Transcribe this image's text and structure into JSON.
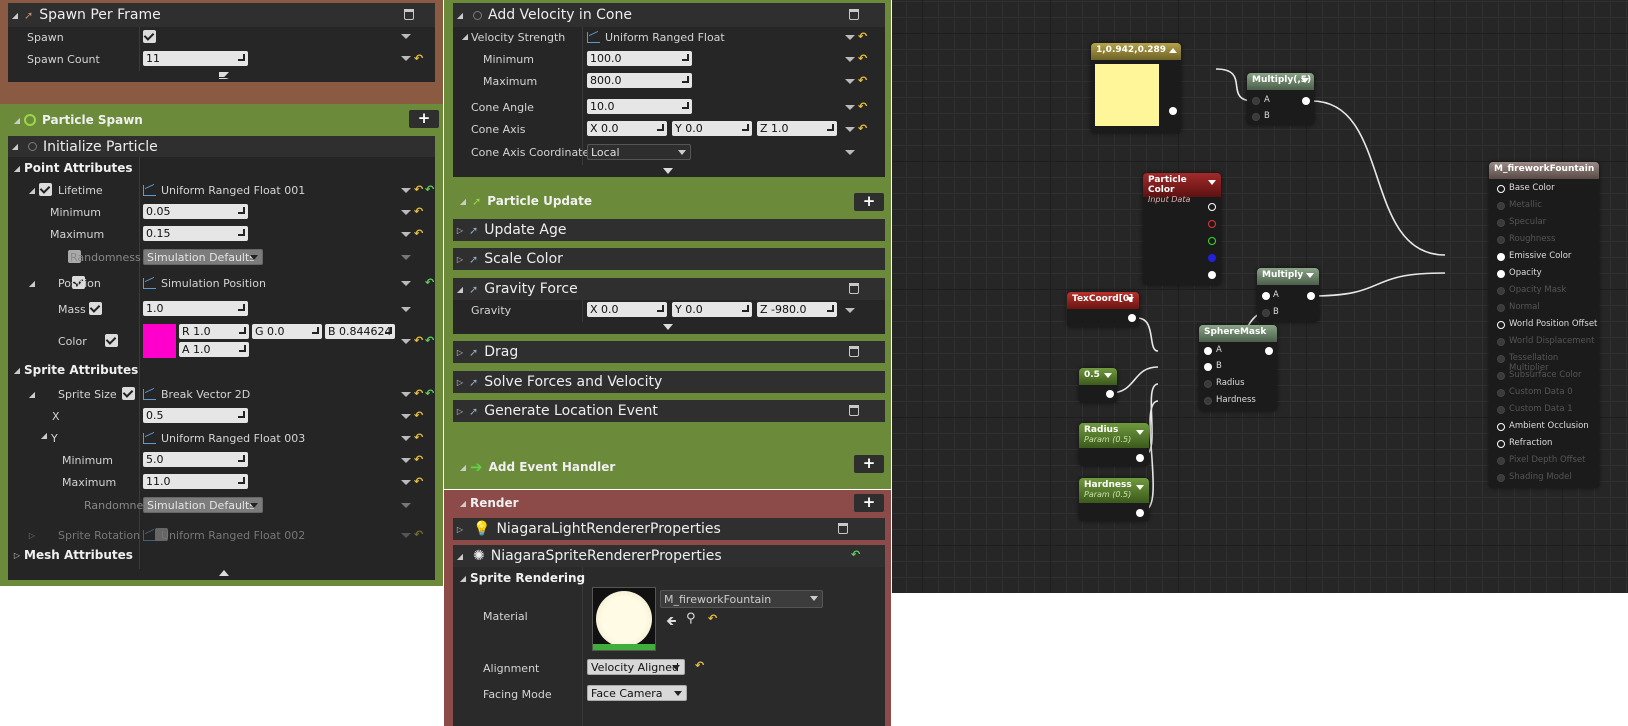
{
  "left": {
    "spawn_per_frame": {
      "title": "Spawn Per Frame",
      "spawn_label": "Spawn",
      "spawn_count_label": "Spawn Count",
      "spawn_count": "11"
    },
    "particle_spawn": {
      "title": "Particle Spawn"
    },
    "initialize": {
      "title": "Initialize Particle",
      "point_attributes": "Point Attributes",
      "lifetime": {
        "label": "Lifetime",
        "mode": "Uniform Ranged Float 001",
        "min_label": "Minimum",
        "min": "0.05",
        "max_label": "Maximum",
        "max": "0.15",
        "randomness_label": "Randomness",
        "randomness": "Simulation Defaults"
      },
      "position": {
        "label": "Position",
        "mode": "Simulation Position"
      },
      "mass": {
        "label": "Mass",
        "value": "1.0"
      },
      "color": {
        "label": "Color",
        "r": "R  1.0",
        "g": "G  0.0",
        "b": "B  0.844624",
        "a": "A  1.0",
        "swatch": "#ff00cc"
      },
      "sprite_attributes": "Sprite Attributes",
      "sprite_size": {
        "label": "Sprite Size",
        "mode": "Break Vector 2D",
        "x_label": "X",
        "x": "0.5",
        "y_label": "Y",
        "y_mode": "Uniform Ranged Float 003",
        "min_label": "Minimum",
        "min": "5.0",
        "max_label": "Maximum",
        "max": "11.0",
        "randomness_label": "Randomne",
        "randomness": "Simulation Defaults"
      },
      "sprite_rotation": {
        "label": "Sprite Rotation",
        "mode": "Uniform Ranged Float 002"
      },
      "mesh_attributes": "Mesh Attributes"
    }
  },
  "middle": {
    "cone": {
      "title": "Add Velocity in Cone",
      "vs_label": "Velocity Strength",
      "vs_mode": "Uniform Ranged Float",
      "min_label": "Minimum",
      "min": "100.0",
      "max_label": "Maximum",
      "max": "800.0",
      "angle_label": "Cone Angle",
      "angle": "10.0",
      "axis_label": "Cone Axis",
      "axis_x": "X  0.0",
      "axis_y": "Y  0.0",
      "axis_z": "Z  1.0",
      "coord_label": "Cone Axis Coordinate",
      "coord": "Local"
    },
    "update": {
      "title": "Particle Update",
      "update_age": "Update Age",
      "scale_color": "Scale Color",
      "gravity_force": "Gravity Force",
      "gravity_label": "Gravity",
      "gx": "X  0.0",
      "gy": "Y  0.0",
      "gz": "Z  -980.0",
      "drag": "Drag",
      "solve": "Solve Forces and Velocity",
      "gen_loc": "Generate Location Event",
      "add_event": "Add Event Handler"
    },
    "render": {
      "title": "Render",
      "light": "NiagaraLightRendererProperties",
      "sprite": "NiagaraSpriteRendererProperties",
      "sprite_rendering": "Sprite Rendering",
      "material_label": "Material",
      "material": "M_fireworkFountain",
      "alignment_label": "Alignment",
      "alignment": "Velocity Aligned",
      "facing_label": "Facing Mode",
      "facing": "Face Camera"
    }
  },
  "graph": {
    "const_node": {
      "title": "1,0.942,0.289",
      "swatch": "#fff69a"
    },
    "multiply1": {
      "title": "Multiply(,5)",
      "a": "A",
      "b": "B"
    },
    "particle_color": {
      "title": "Particle Color",
      "sub": "Input Data"
    },
    "multiply2": {
      "title": "Multiply",
      "a": "A",
      "b": "B"
    },
    "texcoord": {
      "title": "TexCoord[0]"
    },
    "spheremask": {
      "title": "SphereMask",
      "a": "A",
      "b": "B",
      "radius": "Radius",
      "hardness": "Hardness"
    },
    "half": {
      "title": "0.5"
    },
    "radius": {
      "title": "Radius",
      "sub": "Param (0.5)"
    },
    "hardness": {
      "title": "Hardness",
      "sub": "Param (0.5)"
    },
    "material": {
      "title": "M_fireworkFountain",
      "pins": [
        "Base Color",
        "Metallic",
        "Specular",
        "Roughness",
        "Emissive Color",
        "Opacity",
        "Opacity Mask",
        "Normal",
        "World Position Offset",
        "World Displacement",
        "Tessellation Multiplier",
        "Subsurface Color",
        "Custom Data 0",
        "Custom Data 1",
        "Ambient Occlusion",
        "Refraction",
        "Pixel Depth Offset",
        "Shading Model"
      ]
    }
  }
}
